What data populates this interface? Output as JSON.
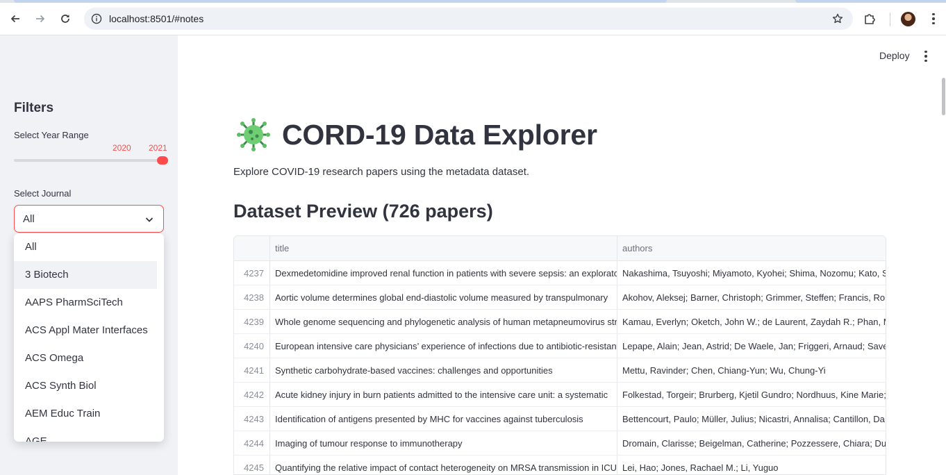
{
  "browser": {
    "url": "localhost:8501/#notes"
  },
  "sidebar": {
    "title": "Filters",
    "year_range": {
      "label": "Select Year Range",
      "min_value": "2020",
      "max_value": "2021"
    },
    "journal": {
      "label": "Select Journal",
      "selected": "All",
      "options": [
        "All",
        "3 Biotech",
        "AAPS PharmSciTech",
        "ACS Appl Mater Interfaces",
        "ACS Omega",
        "ACS Synth Biol",
        "AEM Educ Train",
        "AGE"
      ],
      "highlighted_index": 1
    }
  },
  "header": {
    "deploy_label": "Deploy"
  },
  "main": {
    "title": "CORD-19 Data Explorer",
    "intro": "Explore COVID-19 research papers using the metadata dataset.",
    "preview_heading": "Dataset Preview (726 papers)",
    "table": {
      "columns": [
        "title",
        "authors"
      ],
      "rows": [
        {
          "index": "4237",
          "title": "Dexmedetomidine improved renal function in patients with severe sepsis: an exploratory",
          "authors": "Nakashima, Tsuyoshi; Miyamoto, Kyohei; Shima, Nozomu; Kato, Seiya"
        },
        {
          "index": "4238",
          "title": "Aortic volume determines global end-diastolic volume measured by transpulmonary",
          "authors": "Akohov, Aleksej; Barner, Christoph; Grimmer, Steffen; Francis, Roland"
        },
        {
          "index": "4239",
          "title": "Whole genome sequencing and phylogenetic analysis of human metapneumovirus strains",
          "authors": "Kamau, Everlyn; Oketch, John W.; de Laurent, Zaydah R.; Phan, My"
        },
        {
          "index": "4240",
          "title": "European intensive care physicians’ experience of infections due to antibiotic-resistant",
          "authors": "Lepape, Alain; Jean, Astrid; De Waele, Jan; Friggeri, Arnaud; Savey"
        },
        {
          "index": "4241",
          "title": "Synthetic carbohydrate-based vaccines: challenges and opportunities",
          "authors": "Mettu, Ravinder; Chen, Chiang-Yun; Wu, Chung-Yi"
        },
        {
          "index": "4242",
          "title": "Acute kidney injury in burn patients admitted to the intensive care unit: a systematic",
          "authors": "Folkestad, Torgeir; Brurberg, Kjetil Gundro; Nordhuus, Kine Marie;"
        },
        {
          "index": "4243",
          "title": "Identification of antigens presented by MHC for vaccines against tuberculosis",
          "authors": "Bettencourt, Paulo; Müller, Julius; Nicastri, Annalisa; Cantillon, Da"
        },
        {
          "index": "4244",
          "title": "Imaging of tumour response to immunotherapy",
          "authors": "Dromain, Clarisse; Beigelman, Catherine; Pozzessere, Chiara; Dura"
        },
        {
          "index": "4245",
          "title": "Quantifying the relative impact of contact heterogeneity on MRSA transmission in ICU",
          "authors": "Lei, Hao; Jones, Rachael M.; Li, Yuguo"
        }
      ]
    }
  },
  "colors": {
    "accent": "#ff4b4b",
    "sidebar_bg": "#f0f2f6",
    "text": "#31333f"
  },
  "icons": [
    "back-icon",
    "forward-icon",
    "reload-icon",
    "site-info-icon",
    "bookmark-star-icon",
    "extensions-icon",
    "profile-avatar",
    "browser-menu-icon",
    "app-menu-icon",
    "chevron-down-icon",
    "virus-icon"
  ]
}
